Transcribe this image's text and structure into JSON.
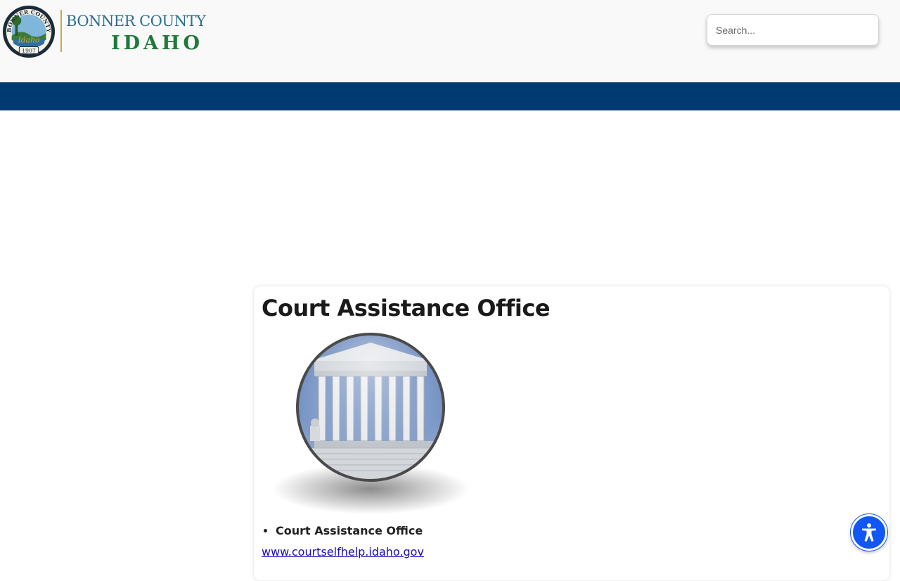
{
  "header": {
    "logo": {
      "line1": "BONNER COUNTY",
      "line2": "IDAHO",
      "seal_text_top": "BONNER COUNTY",
      "seal_text_year": "1907",
      "seal_text_script": "Idaho"
    },
    "search": {
      "placeholder": "Search..."
    }
  },
  "navbar": {
    "color": "#003a70"
  },
  "main": {
    "title": "Court Assistance Office",
    "image_icon": "supreme-court-building-globe",
    "list_items": [
      "Court Assistance Office"
    ],
    "link_text": "www.courtselfhelp.idaho.gov"
  },
  "accessibility": {
    "icon": "accessibility-person-icon",
    "color": "#1256f5"
  }
}
